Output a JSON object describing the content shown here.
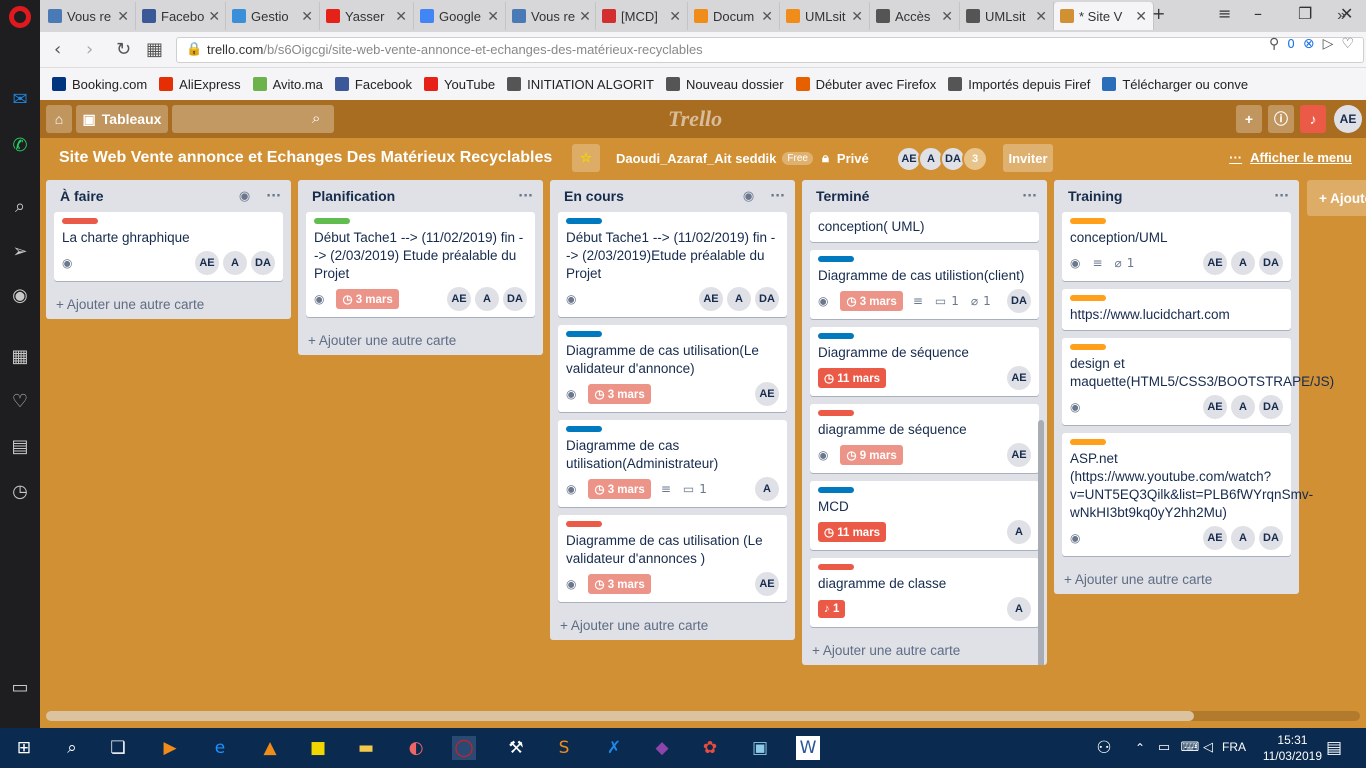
{
  "browser": {
    "tabs": [
      {
        "label": "Vous re",
        "icon": "graduation-cap-icon",
        "color": "#4a7ab5"
      },
      {
        "label": "Facebo",
        "icon": "facebook-icon",
        "color": "#3b5998"
      },
      {
        "label": "Gestio",
        "icon": "code-icon",
        "color": "#3a8fd9"
      },
      {
        "label": "Yasser",
        "icon": "youtube-icon",
        "color": "#e62117"
      },
      {
        "label": "Google",
        "icon": "google-translate-icon",
        "color": "#4285f4"
      },
      {
        "label": "Vous re",
        "icon": "graduation-cap-icon",
        "color": "#4a7ab5"
      },
      {
        "label": "[MCD]",
        "icon": "pdf-icon",
        "color": "#d32f2f"
      },
      {
        "label": "Docum",
        "icon": "doc-icon",
        "color": "#f08c1a"
      },
      {
        "label": "UMLsit",
        "icon": "doc-icon",
        "color": "#f08c1a"
      },
      {
        "label": "Accès",
        "icon": "grid-icon",
        "color": "#555555"
      },
      {
        "label": "UMLsit",
        "icon": "doc-icon",
        "color": "#555555"
      },
      {
        "label": "* Site V",
        "icon": "trello-icon",
        "color": "#d29034"
      }
    ],
    "url": {
      "domain": "trello.com",
      "path": "/b/s6Oigcgi/site-web-vente-annonce-et-echanges-des-matérieux-recyclables",
      "badge": "0"
    },
    "bookmarks": [
      {
        "label": "Booking.com",
        "color": "#003580"
      },
      {
        "label": "AliExpress",
        "color": "#e62e04"
      },
      {
        "label": "Avito.ma",
        "color": "#6bb34a"
      },
      {
        "label": "Facebook",
        "color": "#3b5998"
      },
      {
        "label": "YouTube",
        "color": "#e62117"
      },
      {
        "label": "INITIATION ALGORIT",
        "color": "#555555"
      },
      {
        "label": "Nouveau dossier",
        "color": "#555555"
      },
      {
        "label": "Débuter avec Firefox",
        "color": "#e66000"
      },
      {
        "label": "Importés depuis Firef",
        "color": "#555555"
      },
      {
        "label": "Télécharger ou conve",
        "color": "#2a6ebb"
      }
    ],
    "bookmarks_more": "»"
  },
  "trello": {
    "boards_label": "Tableaux",
    "logo": "Trello",
    "header_avatar": "AE",
    "board_title": "Site Web Vente annonce et Echanges Des Matérieux Recyclables",
    "team": "Daoudi_Azaraf_Ait seddik",
    "team_badge": "Free",
    "visibility": "Privé",
    "members": [
      "AE",
      "A",
      "DA"
    ],
    "members_count": "3",
    "invite": "Inviter",
    "menu": "Afficher le menu",
    "add_list": "+ Ajoute",
    "lists": [
      {
        "title": "À faire",
        "watch": true,
        "cards": [
          {
            "label_color": "#eb5a46",
            "title": "La charte ghraphique",
            "watch": true,
            "members": [
              "AE",
              "A",
              "DA"
            ]
          }
        ],
        "add_card": "+ Ajouter une autre carte"
      },
      {
        "title": "Planification",
        "watch": false,
        "cards": [
          {
            "label_color": "#61bd4f",
            "title": "Début Tache1 --> (11/02/2019) fin --> (2/03/2019) Etude préalable du Projet",
            "watch": true,
            "due": "3 mars",
            "members": [
              "AE",
              "A",
              "DA"
            ]
          }
        ],
        "add_card": "+ Ajouter une autre carte"
      },
      {
        "title": "En cours",
        "watch": true,
        "cards": [
          {
            "label_color": "#0079bf",
            "title": "Début Tache1 --> (11/02/2019) fin --> (2/03/2019)Etude préalable du Projet",
            "watch": true,
            "members": [
              "AE",
              "A",
              "DA"
            ]
          },
          {
            "label_color": "#0079bf",
            "title": "Diagramme de cas utilisation(Le validateur d'annonce)",
            "watch": true,
            "due": "3 mars",
            "members": [
              "AE"
            ]
          },
          {
            "label_color": "#0079bf",
            "title": "Diagramme de cas utilisation(Administrateur)",
            "watch": true,
            "due": "3 mars",
            "desc": true,
            "comments": "1",
            "members": [
              "A"
            ]
          },
          {
            "label_color": "#eb5a46",
            "title": "Diagramme de cas utilisation (Le validateur d'annonces )",
            "watch": true,
            "due": "3 mars",
            "members": [
              "AE"
            ]
          }
        ],
        "add_card": "+ Ajouter une autre carte"
      },
      {
        "title": "Terminé",
        "watch": false,
        "cards": [
          {
            "label_color": "",
            "title": "conception( UML)"
          },
          {
            "label_color": "#0079bf",
            "title": "Diagramme de cas utilistion(client)",
            "watch": true,
            "due": "3 mars",
            "desc": true,
            "comments": "1",
            "attachments": "1",
            "members": [
              "DA"
            ]
          },
          {
            "label_color": "#0079bf",
            "title": "Diagramme de séquence",
            "due": "11 mars",
            "due_red": true,
            "members": [
              "AE"
            ]
          },
          {
            "label_color": "#eb5a46",
            "title": "diagramme de séquence",
            "watch": true,
            "due": "9 mars",
            "members": [
              "AE"
            ]
          },
          {
            "label_color": "#0079bf",
            "title": "MCD",
            "due": "11 mars",
            "due_red": true,
            "members": [
              "A"
            ]
          },
          {
            "label_color": "#eb5a46",
            "title": "diagramme de classe",
            "due": "1",
            "due_red": true,
            "alarm": true,
            "members": [
              "A"
            ]
          }
        ],
        "add_card": "+ Ajouter une autre carte"
      },
      {
        "title": "Training",
        "watch": false,
        "cards": [
          {
            "label_color": "#ff9f1a",
            "title": "conception/UML",
            "watch": true,
            "desc": true,
            "attachments": "1",
            "members": [
              "AE",
              "A",
              "DA"
            ]
          },
          {
            "label_color": "#ff9f1a",
            "title": "https://www.lucidchart.com"
          },
          {
            "label_color": "#ff9f1a",
            "title": "design et maquette(HTML5/CSS3/BOOTSTRAPE/JS)",
            "watch": true,
            "members": [
              "AE",
              "A",
              "DA"
            ]
          },
          {
            "label_color": "#ff9f1a",
            "title": "ASP.net (https://www.youtube.com/watch?v=UNT5EQ3Qilk&list=PLB6fWYrqnSmv-wNkHI3bt9kq0yY2hh2Mu)",
            "watch": true,
            "members": [
              "AE",
              "A",
              "DA"
            ]
          }
        ],
        "add_card": "+ Ajouter une autre carte"
      }
    ]
  },
  "taskbar": {
    "lang": "FRA",
    "time": "15:31",
    "date": "11/03/2019"
  }
}
